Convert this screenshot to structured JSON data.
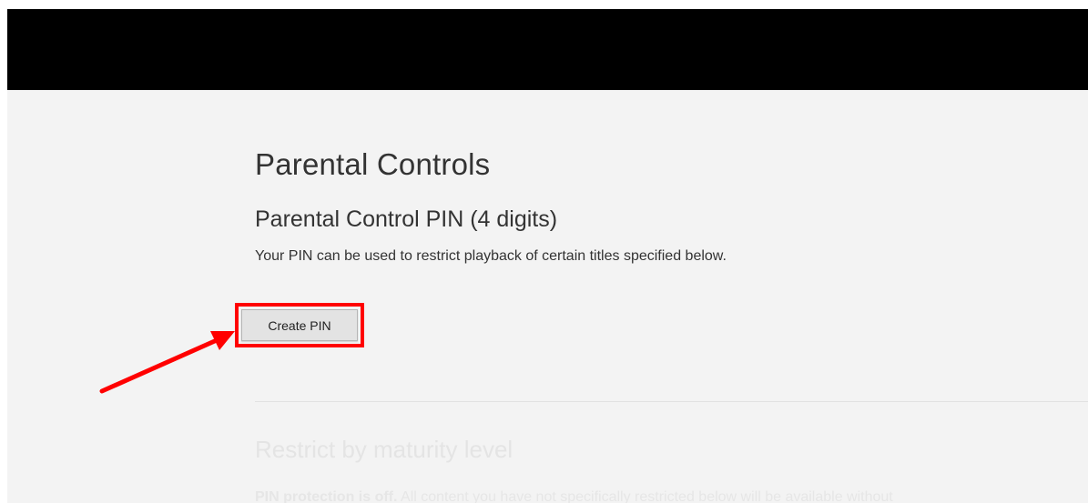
{
  "main": {
    "page_title": "Parental Controls",
    "pin_section": {
      "title": "Parental Control PIN (4 digits)",
      "description": "Your PIN can be used to restrict playback of certain titles specified below.",
      "create_pin_label": "Create PIN"
    },
    "maturity_section": {
      "title": "Restrict by maturity level",
      "status_bold": "PIN protection is off.",
      "status_rest": " All content you have not specifically restricted below will be available without"
    }
  },
  "annotation": {
    "highlight_color": "#ff0000",
    "arrow_color": "#ff0000"
  },
  "colors": {
    "header_background": "#000000",
    "page_background": "#f3f3f3"
  }
}
